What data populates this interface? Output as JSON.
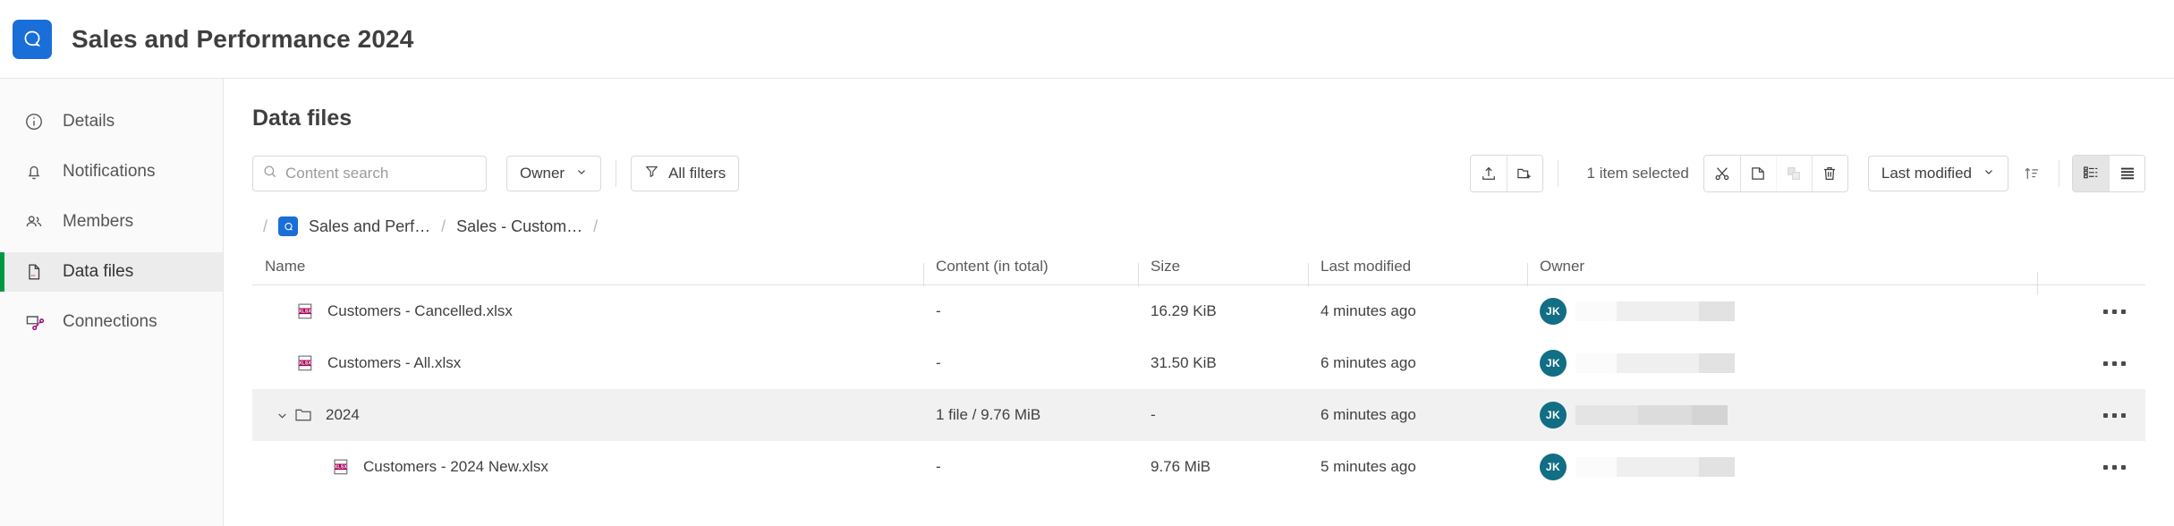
{
  "header": {
    "app_icon": "app-logo-icon",
    "title": "Sales and Performance 2024"
  },
  "sidebar": {
    "items": [
      {
        "label": "Details",
        "icon": "info-icon",
        "active": false
      },
      {
        "label": "Notifications",
        "icon": "bell-icon",
        "active": false
      },
      {
        "label": "Members",
        "icon": "members-icon",
        "active": false
      },
      {
        "label": "Data files",
        "icon": "data-file-icon",
        "active": true
      },
      {
        "label": "Connections",
        "icon": "connections-icon",
        "active": false
      }
    ],
    "active_accent": "#009845"
  },
  "main": {
    "page_title": "Data files",
    "toolbar": {
      "search_placeholder": "Content search",
      "search_value": "",
      "owner_label": "Owner",
      "all_filters_label": "All filters",
      "upload_icon": "upload-icon",
      "new_folder_icon": "new-folder-icon",
      "selection_text": "1 item selected",
      "cut_icon": "scissors-icon",
      "copy_icon": "copy-icon",
      "paste_icon": "paste-icon",
      "delete_icon": "trash-icon",
      "sort_label": "Last modified",
      "sort_direction_icon": "sort-ascending-icon",
      "tree_view_icon": "tree-view-icon",
      "list_view_icon": "list-view-icon",
      "active_view": "tree"
    },
    "breadcrumb": {
      "leading_slash": "/",
      "separator": "/",
      "trailing_slash": "/",
      "items": [
        {
          "label": "Sales and Perf…",
          "has_badge": true
        },
        {
          "label": "Sales - Custom…",
          "has_badge": false
        }
      ]
    },
    "table": {
      "columns": [
        "Name",
        "Content (in total)",
        "Size",
        "Last modified",
        "Owner"
      ],
      "rows": [
        {
          "name": "Customers - Cancelled.xlsx",
          "icon": "xlsx-file-icon",
          "type": "file",
          "indent": 1,
          "content": "-",
          "size": "16.29 KiB",
          "modified": "4 minutes ago",
          "owner_initials": "JK",
          "selected": false
        },
        {
          "name": "Customers - All.xlsx",
          "icon": "xlsx-file-icon",
          "type": "file",
          "indent": 1,
          "content": "-",
          "size": "31.50 KiB",
          "modified": "6 minutes ago",
          "owner_initials": "JK",
          "selected": false
        },
        {
          "name": "2024",
          "icon": "folder-icon",
          "type": "folder",
          "indent": 0,
          "expanded": true,
          "content": "1 file / 9.76 MiB",
          "size": "-",
          "modified": "6 minutes ago",
          "owner_initials": "JK",
          "selected": true
        },
        {
          "name": "Customers - 2024 New.xlsx",
          "icon": "xlsx-file-icon",
          "type": "file",
          "indent": 2,
          "content": "-",
          "size": "9.76 MiB",
          "modified": "5 minutes ago",
          "owner_initials": "JK",
          "selected": false
        }
      ]
    }
  },
  "colors": {
    "brand_blue": "#1a6ed8",
    "accent_green": "#009845",
    "avatar_teal": "#116e84",
    "xlsx_magenta": "#a5005a"
  }
}
